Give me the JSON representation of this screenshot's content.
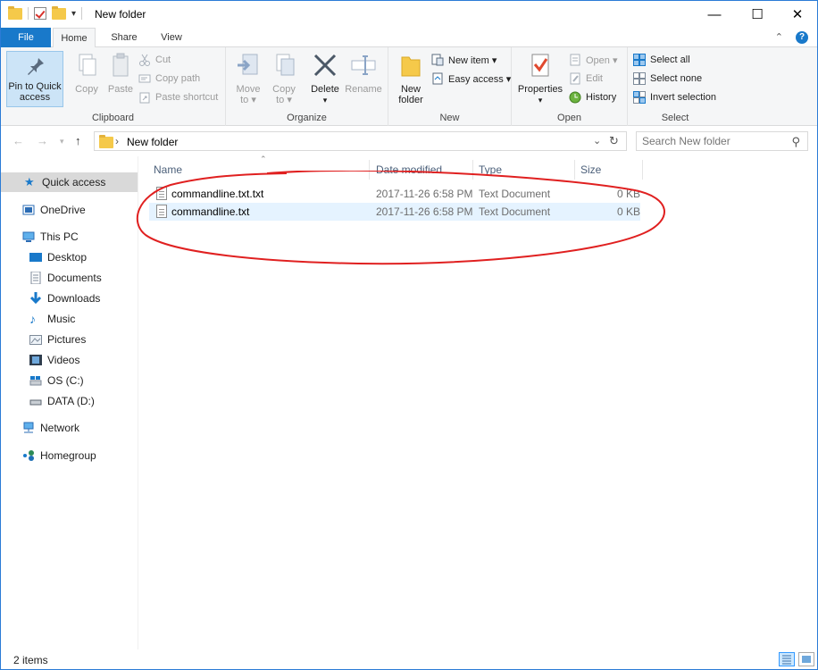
{
  "window": {
    "title": "New folder",
    "minimize_glyph": "—",
    "maximize_glyph": "☐",
    "close_glyph": "✕"
  },
  "ribbon_tabs": {
    "file": "File",
    "home": "Home",
    "share": "Share",
    "view": "View"
  },
  "clipboard": {
    "pin_line1": "Pin to Quick",
    "pin_line2": "access",
    "copy": "Copy",
    "paste": "Paste",
    "cut": "Cut",
    "copy_path": "Copy path",
    "paste_shortcut": "Paste shortcut",
    "label": "Clipboard"
  },
  "organize": {
    "move_to_line1": "Move",
    "move_to_line2": "to ▾",
    "copy_to_line1": "Copy",
    "copy_to_line2": "to ▾",
    "delete": "Delete",
    "delete_arrow": "▾",
    "rename": "Rename",
    "label": "Organize"
  },
  "new_group": {
    "new_folder_line1": "New",
    "new_folder_line2": "folder",
    "new_item": "New item ▾",
    "easy_access": "Easy access ▾",
    "label": "New"
  },
  "open_group": {
    "properties": "Properties",
    "properties_arrow": "▾",
    "open": "Open ▾",
    "edit": "Edit",
    "history": "History",
    "label": "Open"
  },
  "select_group": {
    "select_all": "Select all",
    "select_none": "Select none",
    "invert_selection": "Invert selection",
    "label": "Select"
  },
  "address": {
    "crumb": "New folder",
    "search_placeholder": "Search New folder"
  },
  "nav": {
    "quick_access": "Quick access",
    "onedrive": "OneDrive",
    "this_pc": "This PC",
    "desktop": "Desktop",
    "documents": "Documents",
    "downloads": "Downloads",
    "music": "Music",
    "pictures": "Pictures",
    "videos": "Videos",
    "os_c": "OS (C:)",
    "data_d": "DATA (D:)",
    "network": "Network",
    "homegroup": "Homegroup"
  },
  "columns": {
    "name": "Name",
    "date": "Date modified",
    "type": "Type",
    "size": "Size"
  },
  "files": [
    {
      "name": "commandline.txt.txt",
      "date": "2017-11-26 6:58 PM",
      "type": "Text Document",
      "size": "0 KB"
    },
    {
      "name": "commandline.txt",
      "date": "2017-11-26 6:58 PM",
      "type": "Text Document",
      "size": "0 KB"
    }
  ],
  "status": {
    "items": "2 items"
  },
  "colors": {
    "accent": "#1979ca",
    "annotation": "#e02020"
  }
}
